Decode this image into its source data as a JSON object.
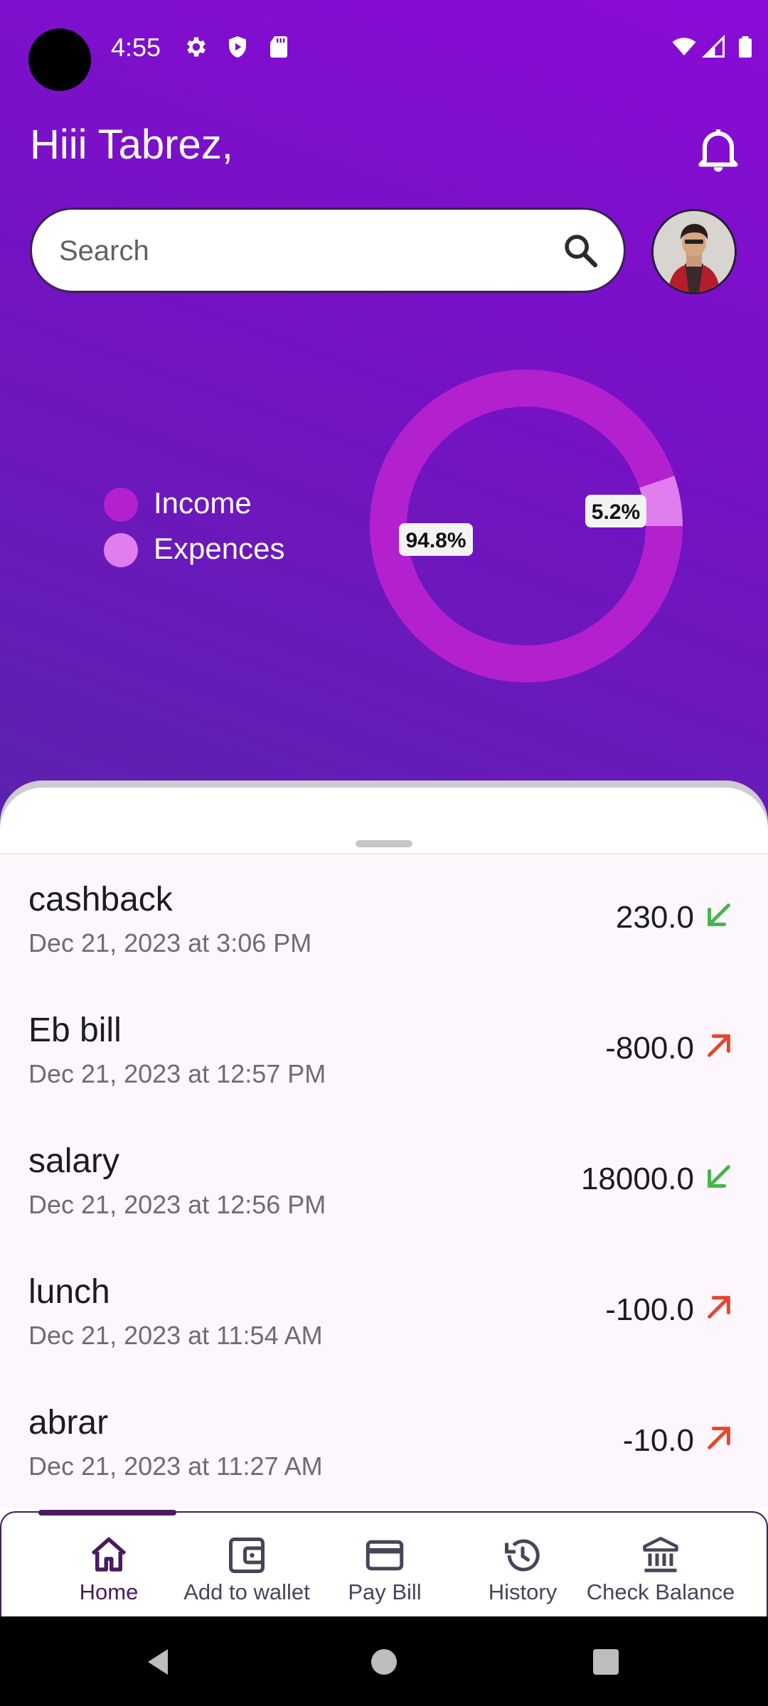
{
  "status_bar": {
    "time": "4:55",
    "left_icons": [
      "gear-icon",
      "shield-icon",
      "sd-card-icon"
    ],
    "right_icons": [
      "wifi-icon",
      "signal-icon",
      "battery-icon"
    ]
  },
  "header": {
    "greeting": "Hiii Tabrez,",
    "bell_icon": "bell-icon"
  },
  "search": {
    "placeholder": "Search",
    "icon": "search-icon"
  },
  "avatar": {
    "icon": "user-avatar"
  },
  "chart_data": {
    "type": "pie",
    "variant": "donut",
    "series": [
      {
        "name": "Income",
        "value": 94.8,
        "label": "94.8%",
        "color": "#b321cf"
      },
      {
        "name": "Expences",
        "value": 5.2,
        "label": "5.2%",
        "color": "#e07ef0"
      }
    ],
    "legend_placement": "left"
  },
  "transactions": [
    {
      "title": "cashback",
      "date": "Dec 21, 2023 at 3:06 PM",
      "amount": "230.0",
      "direction": "in"
    },
    {
      "title": "Eb bill",
      "date": "Dec 21, 2023 at 12:57 PM",
      "amount": "-800.0",
      "direction": "out"
    },
    {
      "title": "salary",
      "date": "Dec 21, 2023 at 12:56 PM",
      "amount": "18000.0",
      "direction": "in"
    },
    {
      "title": "lunch",
      "date": "Dec 21, 2023 at 11:54 AM",
      "amount": "-100.0",
      "direction": "out"
    },
    {
      "title": "abrar",
      "date": "Dec 21, 2023 at 11:27 AM",
      "amount": "-10.0",
      "direction": "out"
    }
  ],
  "colors": {
    "income_arrow": "#43b649",
    "expense_arrow": "#e8452c",
    "accent": "#4a1a5f"
  },
  "bottom_nav": {
    "items": [
      {
        "label": "Home",
        "icon": "home-icon",
        "active": true
      },
      {
        "label": "Add to wallet",
        "icon": "wallet-icon",
        "active": false
      },
      {
        "label": "Pay Bill",
        "icon": "credit-card-icon",
        "active": false
      },
      {
        "label": "History",
        "icon": "history-icon",
        "active": false
      },
      {
        "label": "Check Balance",
        "icon": "bank-icon",
        "active": false
      }
    ]
  },
  "system_nav": {
    "icons": [
      "back-icon",
      "home-circle-icon",
      "recents-icon"
    ]
  }
}
